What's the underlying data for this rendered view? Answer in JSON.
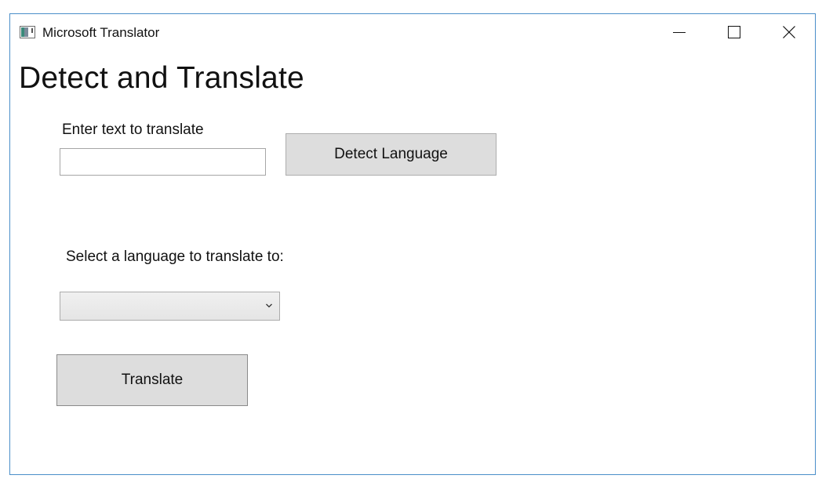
{
  "window": {
    "title": "Microsoft Translator",
    "controls": {
      "minimize": "minimize-icon",
      "maximize": "maximize-icon",
      "close": "close-icon"
    }
  },
  "main": {
    "heading": "Detect and Translate",
    "input": {
      "label": "Enter text to translate",
      "value": "",
      "placeholder": ""
    },
    "detect_button_label": "Detect Language",
    "language": {
      "label": "Select a language to translate to:",
      "selected": ""
    },
    "translate_button_label": "Translate"
  },
  "colors": {
    "window_border": "#4a8ec9",
    "button_bg": "#dddddd",
    "button_border": "#adadad"
  }
}
